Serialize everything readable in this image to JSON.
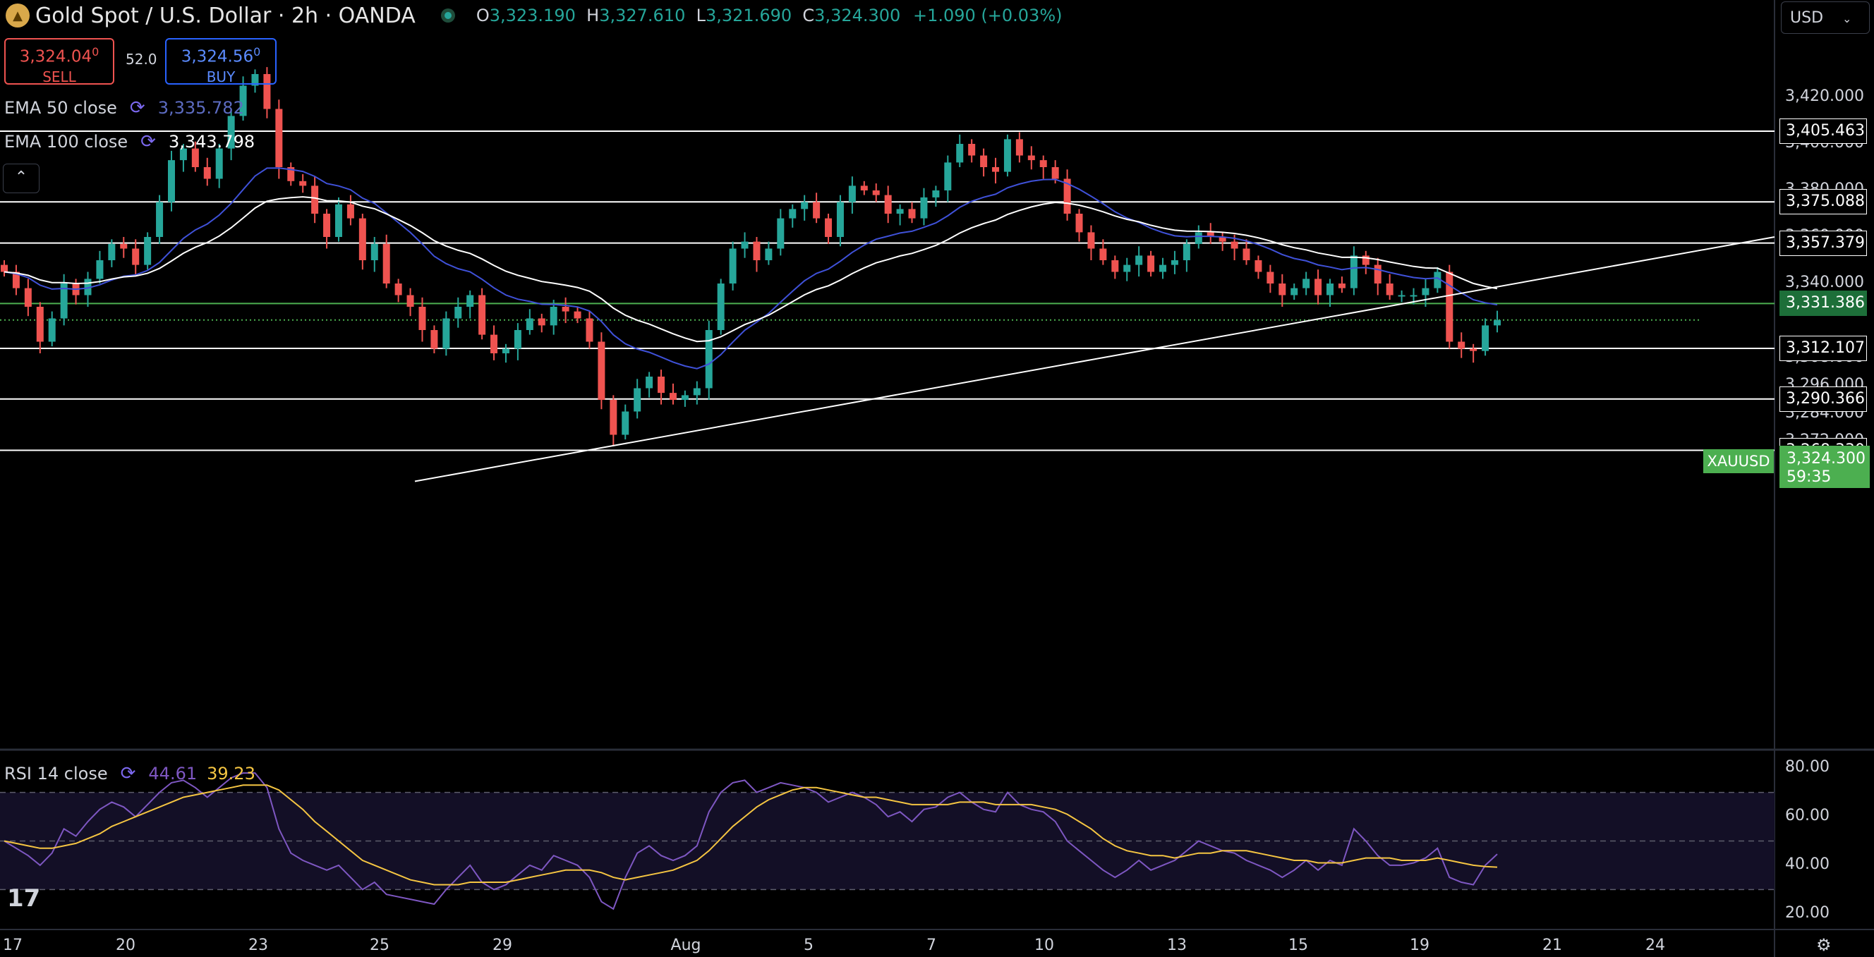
{
  "header": {
    "title": "Gold Spot / U.S. Dollar · 2h · OANDA",
    "open_label": "O",
    "open": "3,323.190",
    "high_label": "H",
    "high": "3,327.610",
    "low_label": "L",
    "low": "3,321.690",
    "close_label": "C",
    "close": "3,324.300",
    "change": "+1.090 (+0.03%)"
  },
  "trade": {
    "sell_price": "3,324.04",
    "sell_sup": "0",
    "sell_label": "SELL",
    "spread": "52.0",
    "buy_price": "3,324.56",
    "buy_sup": "0",
    "buy_label": "BUY"
  },
  "indicators": {
    "ema50_label": "EMA 50 close",
    "ema50_value": "3,335.782",
    "ema100_label": "EMA 100 close",
    "ema100_value": "3,343.798",
    "rsi_label": "RSI 14 close",
    "rsi_value": "44.61",
    "rsi_ma_value": "39.23"
  },
  "currency": "USD",
  "symbol": "XAUUSD",
  "last_price": "3,324.300",
  "countdown": "59:35",
  "colors": {
    "up": "#26a69a",
    "down": "#ef5350",
    "ema50": "#3f51d8",
    "ema100": "#ffffff",
    "rsi": "#7e57c2",
    "rsi_ma": "#f5c542",
    "level_green": "#4caf50"
  },
  "chart_data": [
    {
      "type": "candlestick",
      "y_ticks": [
        "3,420.000",
        "3,400.000",
        "3,380.000",
        "3,360.000",
        "3,340.000",
        "3,308.000",
        "3,296.000",
        "3,284.000",
        "3,272.000",
        "3,260.000"
      ],
      "x_ticks": [
        "17",
        "20",
        "23",
        "25",
        "29",
        "Aug",
        "5",
        "7",
        "10",
        "13",
        "15",
        "19",
        "21",
        "24"
      ],
      "horizontal_levels": [
        {
          "value": 3405.463,
          "label": "3,405.463"
        },
        {
          "value": 3375.088,
          "label": "3,375.088"
        },
        {
          "value": 3357.379,
          "label": "3,357.379"
        },
        {
          "value": 3331.386,
          "label": "3,331.386",
          "color": "green"
        },
        {
          "value": 3312.107,
          "label": "3,312.107"
        },
        {
          "value": 3290.366,
          "label": "3,290.366"
        },
        {
          "value": 3268.33,
          "label": "3,268.330"
        }
      ],
      "trendline": {
        "from": [
          "Jul 25",
          3255
        ],
        "to": [
          "Aug 21",
          3360
        ]
      },
      "last_price_line": 3324.3,
      "closes": [
        3345,
        3338,
        3330,
        3315,
        3325,
        3340,
        3335,
        3342,
        3350,
        3357,
        3355,
        3348,
        3360,
        3375,
        3393,
        3398,
        3390,
        3385,
        3398,
        3412,
        3425,
        3430,
        3415,
        3390,
        3384,
        3382,
        3370,
        3360,
        3374,
        3368,
        3350,
        3357,
        3340,
        3335,
        3330,
        3320,
        3312,
        3325,
        3330,
        3335,
        3318,
        3310,
        3312,
        3320,
        3325,
        3322,
        3330,
        3328,
        3325,
        3315,
        3290,
        3275,
        3285,
        3295,
        3300,
        3293,
        3290,
        3292,
        3295,
        3320,
        3340,
        3355,
        3358,
        3350,
        3355,
        3368,
        3372,
        3375,
        3368,
        3360,
        3375,
        3382,
        3380,
        3378,
        3370,
        3372,
        3368,
        3377,
        3380,
        3392,
        3400,
        3395,
        3390,
        3388,
        3402,
        3395,
        3393,
        3390,
        3385,
        3370,
        3362,
        3355,
        3350,
        3345,
        3348,
        3352,
        3345,
        3348,
        3350,
        3357,
        3362,
        3360,
        3358,
        3355,
        3350,
        3345,
        3340,
        3335,
        3338,
        3342,
        3335,
        3340,
        3338,
        3352,
        3348,
        3340,
        3335,
        3335,
        3335,
        3338,
        3345,
        3315,
        3312,
        3311,
        3322,
        3324.3
      ]
    },
    {
      "type": "line",
      "title": "RSI 14 close",
      "y_ticks": [
        "80.00",
        "60.00",
        "40.00",
        "20.00"
      ],
      "ylim": [
        15,
        85
      ],
      "bands": [
        30,
        50,
        70
      ],
      "series": [
        {
          "name": "RSI",
          "values": [
            50,
            47,
            44,
            40,
            45,
            55,
            52,
            58,
            63,
            66,
            64,
            60,
            65,
            70,
            74,
            75,
            72,
            68,
            72,
            76,
            78,
            78,
            72,
            55,
            45,
            42,
            40,
            38,
            40,
            35,
            30,
            33,
            28,
            27,
            26,
            25,
            24,
            30,
            35,
            40,
            33,
            30,
            32,
            36,
            40,
            38,
            44,
            42,
            40,
            35,
            25,
            22,
            35,
            45,
            48,
            44,
            42,
            44,
            48,
            62,
            70,
            74,
            75,
            70,
            72,
            74,
            73,
            72,
            70,
            66,
            68,
            70,
            68,
            65,
            60,
            62,
            58,
            63,
            64,
            68,
            70,
            66,
            63,
            62,
            70,
            65,
            63,
            62,
            58,
            50,
            46,
            42,
            38,
            35,
            38,
            42,
            38,
            40,
            42,
            46,
            50,
            48,
            46,
            45,
            42,
            40,
            38,
            35,
            38,
            42,
            38,
            42,
            40,
            55,
            50,
            44,
            40,
            40,
            41,
            43,
            47,
            35,
            33,
            32,
            40,
            44.61
          ]
        },
        {
          "name": "RSI MA",
          "values": [
            50,
            49,
            48,
            47,
            47,
            48,
            49,
            51,
            53,
            56,
            58,
            60,
            62,
            64,
            66,
            68,
            69,
            70,
            71,
            72,
            73,
            73,
            73,
            71,
            67,
            63,
            58,
            54,
            50,
            46,
            42,
            40,
            38,
            36,
            34,
            33,
            32,
            32,
            32,
            33,
            33,
            33,
            33,
            34,
            35,
            36,
            37,
            38,
            38,
            38,
            37,
            35,
            34,
            35,
            36,
            37,
            38,
            40,
            42,
            46,
            51,
            56,
            60,
            64,
            67,
            69,
            71,
            72,
            72,
            71,
            70,
            69,
            68,
            68,
            67,
            66,
            65,
            65,
            65,
            65,
            66,
            66,
            66,
            65,
            65,
            65,
            65,
            64,
            63,
            61,
            58,
            55,
            51,
            48,
            46,
            45,
            44,
            44,
            43,
            44,
            45,
            45,
            46,
            46,
            46,
            45,
            44,
            43,
            42,
            42,
            41,
            41,
            41,
            42,
            43,
            43,
            43,
            42,
            42,
            42,
            43,
            42,
            41,
            40,
            39.5,
            39.23
          ]
        }
      ]
    }
  ]
}
